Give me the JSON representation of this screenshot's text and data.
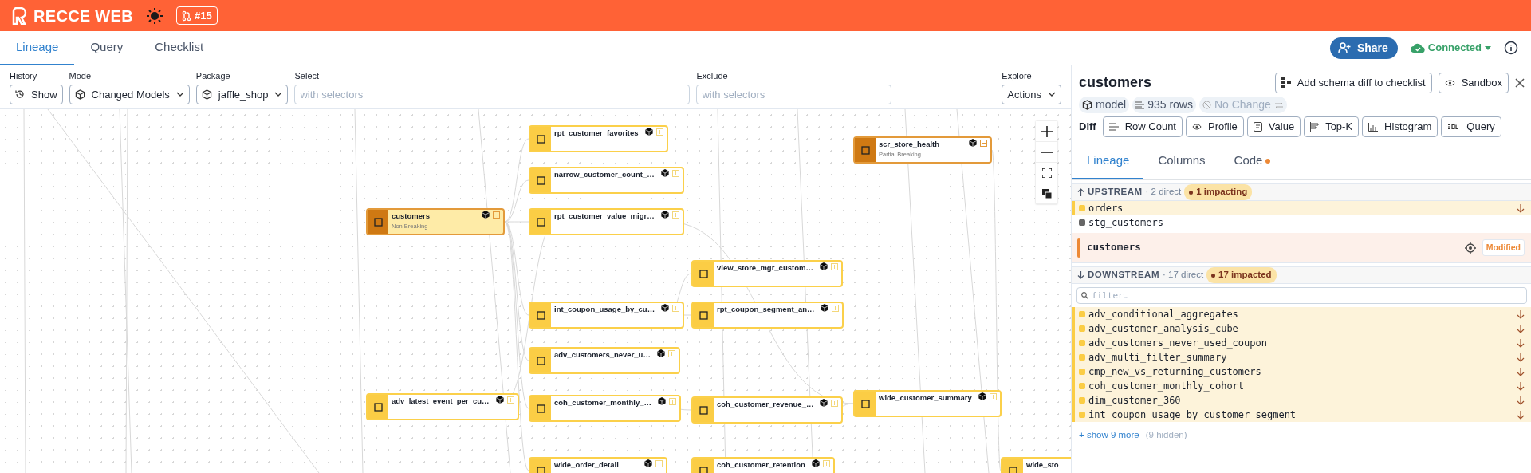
{
  "header": {
    "brand": "RECCE WEB",
    "pr_badge": "#15"
  },
  "tabs": [
    {
      "label": "Lineage",
      "selected": true
    },
    {
      "label": "Query",
      "selected": false
    },
    {
      "label": "Checklist",
      "selected": false
    }
  ],
  "share_button": "Share",
  "connection": {
    "label": "Connected",
    "connected": true
  },
  "toolbar": {
    "history": {
      "label": "History",
      "button": "Show"
    },
    "mode": {
      "label": "Mode",
      "value": "Changed Models"
    },
    "package": {
      "label": "Package",
      "value": "jaffle_shop"
    },
    "select": {
      "label": "Select",
      "placeholder": "with selectors"
    },
    "exclude": {
      "label": "Exclude",
      "placeholder": "with selectors"
    },
    "explore": {
      "label": "Explore",
      "value": "Actions"
    }
  },
  "canvas": {
    "nodes": [
      {
        "name": "rpt_customer_favorites",
        "selected": false,
        "breaking": false
      },
      {
        "name": "scr_store_health",
        "status": "Partial Breaking",
        "selected": false,
        "breaking": true
      },
      {
        "name": "narrow_customer_count_…",
        "selected": false,
        "breaking": false
      },
      {
        "name": "customers",
        "status": "Non Breaking",
        "selected": true,
        "breaking": true
      },
      {
        "name": "rpt_customer_value_migr…",
        "selected": false,
        "breaking": false
      },
      {
        "name": "view_store_mgr_custom…",
        "selected": false,
        "breaking": false
      },
      {
        "name": "int_coupon_usage_by_cu…",
        "selected": false,
        "breaking": false
      },
      {
        "name": "rpt_coupon_segment_an…",
        "selected": false,
        "breaking": false
      },
      {
        "name": "adv_customers_never_u…",
        "selected": false,
        "breaking": false
      },
      {
        "name": "adv_latest_event_per_cu…",
        "selected": false,
        "breaking": false
      },
      {
        "name": "coh_customer_monthly_…",
        "selected": false,
        "breaking": false
      },
      {
        "name": "coh_customer_revenue_…",
        "selected": false,
        "breaking": false
      },
      {
        "name": "wide_customer_summary",
        "selected": false,
        "breaking": false
      },
      {
        "name": "wide_order_detail",
        "selected": false,
        "breaking": false
      },
      {
        "name": "coh_customer_retention",
        "selected": false,
        "breaking": false
      },
      {
        "name": "wide_sto",
        "selected": false,
        "breaking": false
      }
    ]
  },
  "panel": {
    "title": "customers",
    "actions": [
      "Add schema diff to checklist",
      "Sandbox"
    ],
    "chips": [
      {
        "kind": "type",
        "label": "model"
      },
      {
        "kind": "rows",
        "label": "935 rows"
      },
      {
        "kind": "change",
        "label": "No Change"
      }
    ],
    "diff_label": "Diff",
    "diff_buttons": [
      "Row Count",
      "Profile",
      "Value",
      "Top-K",
      "Histogram",
      "Query"
    ],
    "tabs": [
      {
        "label": "Lineage",
        "selected": true,
        "dot": false
      },
      {
        "label": "Columns",
        "selected": false,
        "dot": false
      },
      {
        "label": "Code",
        "selected": false,
        "dot": true
      }
    ],
    "upstream": {
      "title": "UPSTREAM",
      "direct": "· 2 direct",
      "badge": "1 impacting",
      "items": [
        {
          "name": "orders",
          "impacted": true
        },
        {
          "name": "stg_customers",
          "impacted": false
        }
      ]
    },
    "current": {
      "name": "customers",
      "status": "Modified"
    },
    "downstream": {
      "title": "DOWNSTREAM",
      "direct": "· 17 direct",
      "badge": "17 impacted",
      "filter_placeholder": "filter…",
      "items": [
        {
          "name": "adv_conditional_aggregates",
          "impacted": true
        },
        {
          "name": "adv_customer_analysis_cube",
          "impacted": true
        },
        {
          "name": "adv_customers_never_used_coupon",
          "impacted": true
        },
        {
          "name": "adv_multi_filter_summary",
          "impacted": true
        },
        {
          "name": "cmp_new_vs_returning_customers",
          "impacted": true
        },
        {
          "name": "coh_customer_monthly_cohort",
          "impacted": true
        },
        {
          "name": "dim_customer_360",
          "impacted": true
        },
        {
          "name": "int_coupon_usage_by_customer_segment",
          "impacted": true
        }
      ],
      "show_more": "+ show 9 more",
      "hidden": "(9 hidden)"
    }
  }
}
